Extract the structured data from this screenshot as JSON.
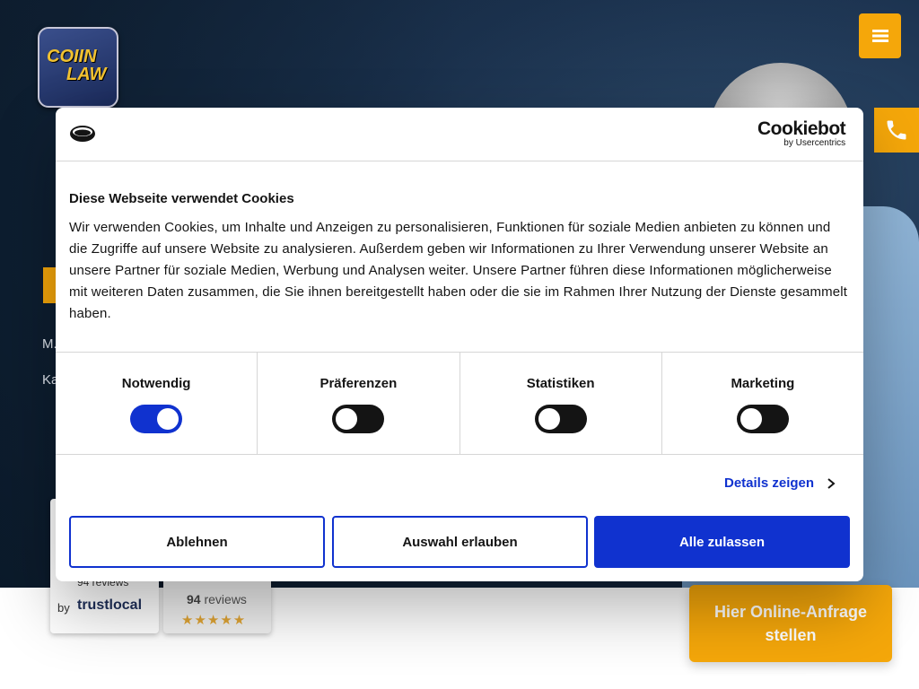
{
  "site": {
    "logo_line1": "COIIN",
    "logo_line2": "LAW",
    "hero_line1": "M.",
    "hero_line2": "Ka",
    "badge1_reviews": "94 reviews",
    "badge1_by": "by",
    "badge1_brand": "trustlocal",
    "badge2_count": "94",
    "badge2_reviews": "reviews",
    "badge2_stars": "★★★★★",
    "cta_label": "Hier Online-Anfrage stellen",
    "accent_color": "#f5a70a"
  },
  "cookie": {
    "brand": "Cookiebot",
    "brand_sub": "by Usercentrics",
    "title": "Diese Webseite verwendet Cookies",
    "text": "Wir verwenden Cookies, um Inhalte und Anzeigen zu personalisieren, Funktionen für soziale Medien anbieten zu können und die Zugriffe auf unsere Website zu analysieren. Außerdem geben wir Informationen zu Ihrer Verwendung unserer Website an unsere Partner für soziale Medien, Werbung und Analysen weiter. Unsere Partner führen diese Informationen möglicherweise mit weiteren Daten zusammen, die Sie ihnen bereitgestellt haben oder die sie im Rahmen Ihrer Nutzung der Dienste gesammelt haben.",
    "categories": [
      {
        "label": "Notwendig",
        "enabled": true
      },
      {
        "label": "Präferenzen",
        "enabled": false
      },
      {
        "label": "Statistiken",
        "enabled": false
      },
      {
        "label": "Marketing",
        "enabled": false
      }
    ],
    "details_link": "Details zeigen",
    "buttons": {
      "decline": "Ablehnen",
      "allow_selection": "Auswahl erlauben",
      "allow_all": "Alle zulassen"
    },
    "primary_color": "#1032cf"
  }
}
